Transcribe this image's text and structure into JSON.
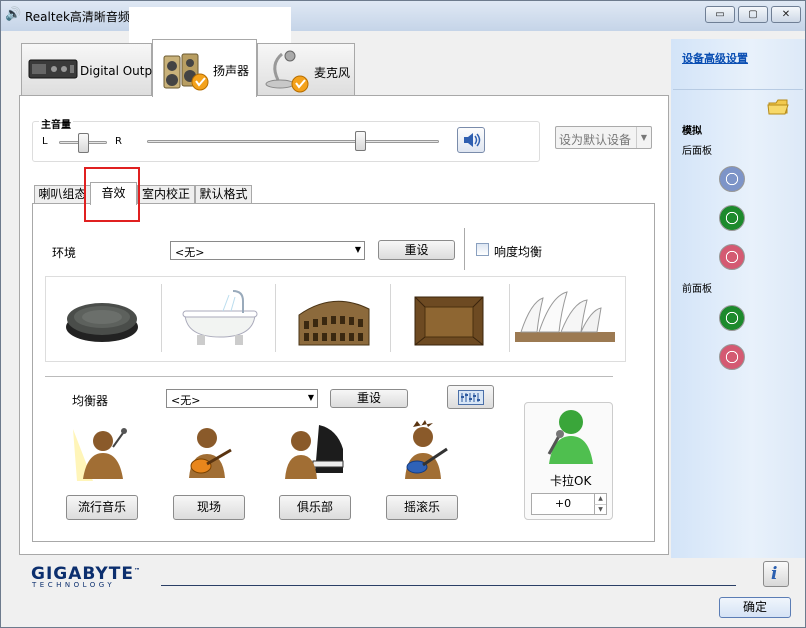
{
  "window": {
    "title": "Realtek高清晰音频",
    "controls": {
      "minimize": "▭",
      "maximize": "▢",
      "close": "✕"
    }
  },
  "device_tabs": [
    {
      "label": "Digital Output",
      "icon": "digital-output-icon",
      "selected": false
    },
    {
      "label": "扬声器",
      "icon": "speaker-icon",
      "selected": true
    },
    {
      "label": "麦克风",
      "icon": "microphone-icon",
      "selected": false
    }
  ],
  "volume": {
    "title": "主音量",
    "balance_left": "L",
    "balance_right": "R",
    "balance_position": 0.5,
    "volume_level": 0.73,
    "mute_icon": "speaker-volume-icon"
  },
  "default_device": {
    "label": "设为默认设备",
    "arrow": "▼"
  },
  "sub_tabs": [
    {
      "label": "喇叭组态",
      "selected": false
    },
    {
      "label": "音效",
      "selected": true
    },
    {
      "label": "室内校正",
      "selected": false
    },
    {
      "label": "默认格式",
      "selected": false
    }
  ],
  "environment": {
    "label": "环境",
    "selected": "<无>",
    "reset": "重设",
    "loudness_label": "响度均衡",
    "loudness_checked": false,
    "presets": [
      "stone-disc-icon",
      "bathtub-icon",
      "colosseum-icon",
      "wooden-room-icon",
      "opera-house-icon"
    ]
  },
  "equalizer": {
    "label": "均衡器",
    "selected": "<无>",
    "reset": "重设",
    "graphic_eq_icon": "graphic-eq-icon",
    "presets": [
      "流行音乐",
      "现场",
      "俱乐部",
      "摇滚乐"
    ]
  },
  "karaoke": {
    "label": "卡拉OK",
    "value": "+0",
    "up": "▲",
    "down": "▼"
  },
  "branding": {
    "name": "GIGABYTE",
    "tagline": "TECHNOLOGY",
    "trademark": "™"
  },
  "buttons": {
    "ok": "确定",
    "info": "i"
  },
  "sidebar": {
    "advanced_link": "设备高级设置",
    "analog_label": "模拟",
    "rear_panel_label": "后面板",
    "front_panel_label": "前面板",
    "colors": {
      "blue": "#7d94c8",
      "green": "#1c8a2c",
      "pink": "#d45a72"
    }
  }
}
